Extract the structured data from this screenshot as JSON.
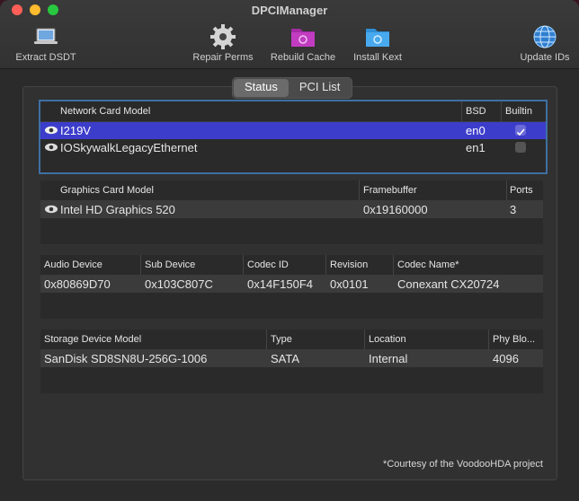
{
  "app": {
    "title": "DPCIManager"
  },
  "toolbar": {
    "extract": "Extract DSDT",
    "repair": "Repair Perms",
    "rebuild": "Rebuild Cache",
    "install": "Install Kext",
    "update": "Update IDs"
  },
  "tabs": {
    "status": "Status",
    "pci": "PCI List"
  },
  "network": {
    "headers": {
      "model": "Network Card Model",
      "bsd": "BSD",
      "builtin": "Builtin"
    },
    "rows": [
      {
        "model": "I219V",
        "bsd": "en0",
        "builtin": true
      },
      {
        "model": "IOSkywalkLegacyEthernet",
        "bsd": "en1",
        "builtin": false
      }
    ]
  },
  "graphics": {
    "headers": {
      "model": "Graphics Card Model",
      "fb": "Framebuffer",
      "ports": "Ports"
    },
    "rows": [
      {
        "model": "Intel HD Graphics 520",
        "fb": "0x19160000",
        "ports": "3"
      }
    ]
  },
  "audio": {
    "headers": {
      "device": "Audio Device",
      "sub": "Sub Device",
      "codec": "Codec ID",
      "rev": "Revision",
      "name": "Codec Name*"
    },
    "rows": [
      {
        "device": "0x80869D70",
        "sub": "0x103C807C",
        "codec": "0x14F150F4",
        "rev": "0x0101",
        "name": "Conexant CX20724"
      }
    ]
  },
  "storage": {
    "headers": {
      "model": "Storage Device Model",
      "type": "Type",
      "loc": "Location",
      "phy": "Phy Blo..."
    },
    "rows": [
      {
        "model": "SanDisk SD8SN8U-256G-1006",
        "type": "SATA",
        "loc": "Internal",
        "phy": "4096"
      }
    ]
  },
  "footer": "*Courtesy of the VoodooHDA project",
  "colors": {
    "selection": "#3d3dcc",
    "focus_ring": "#3f6fa3"
  }
}
